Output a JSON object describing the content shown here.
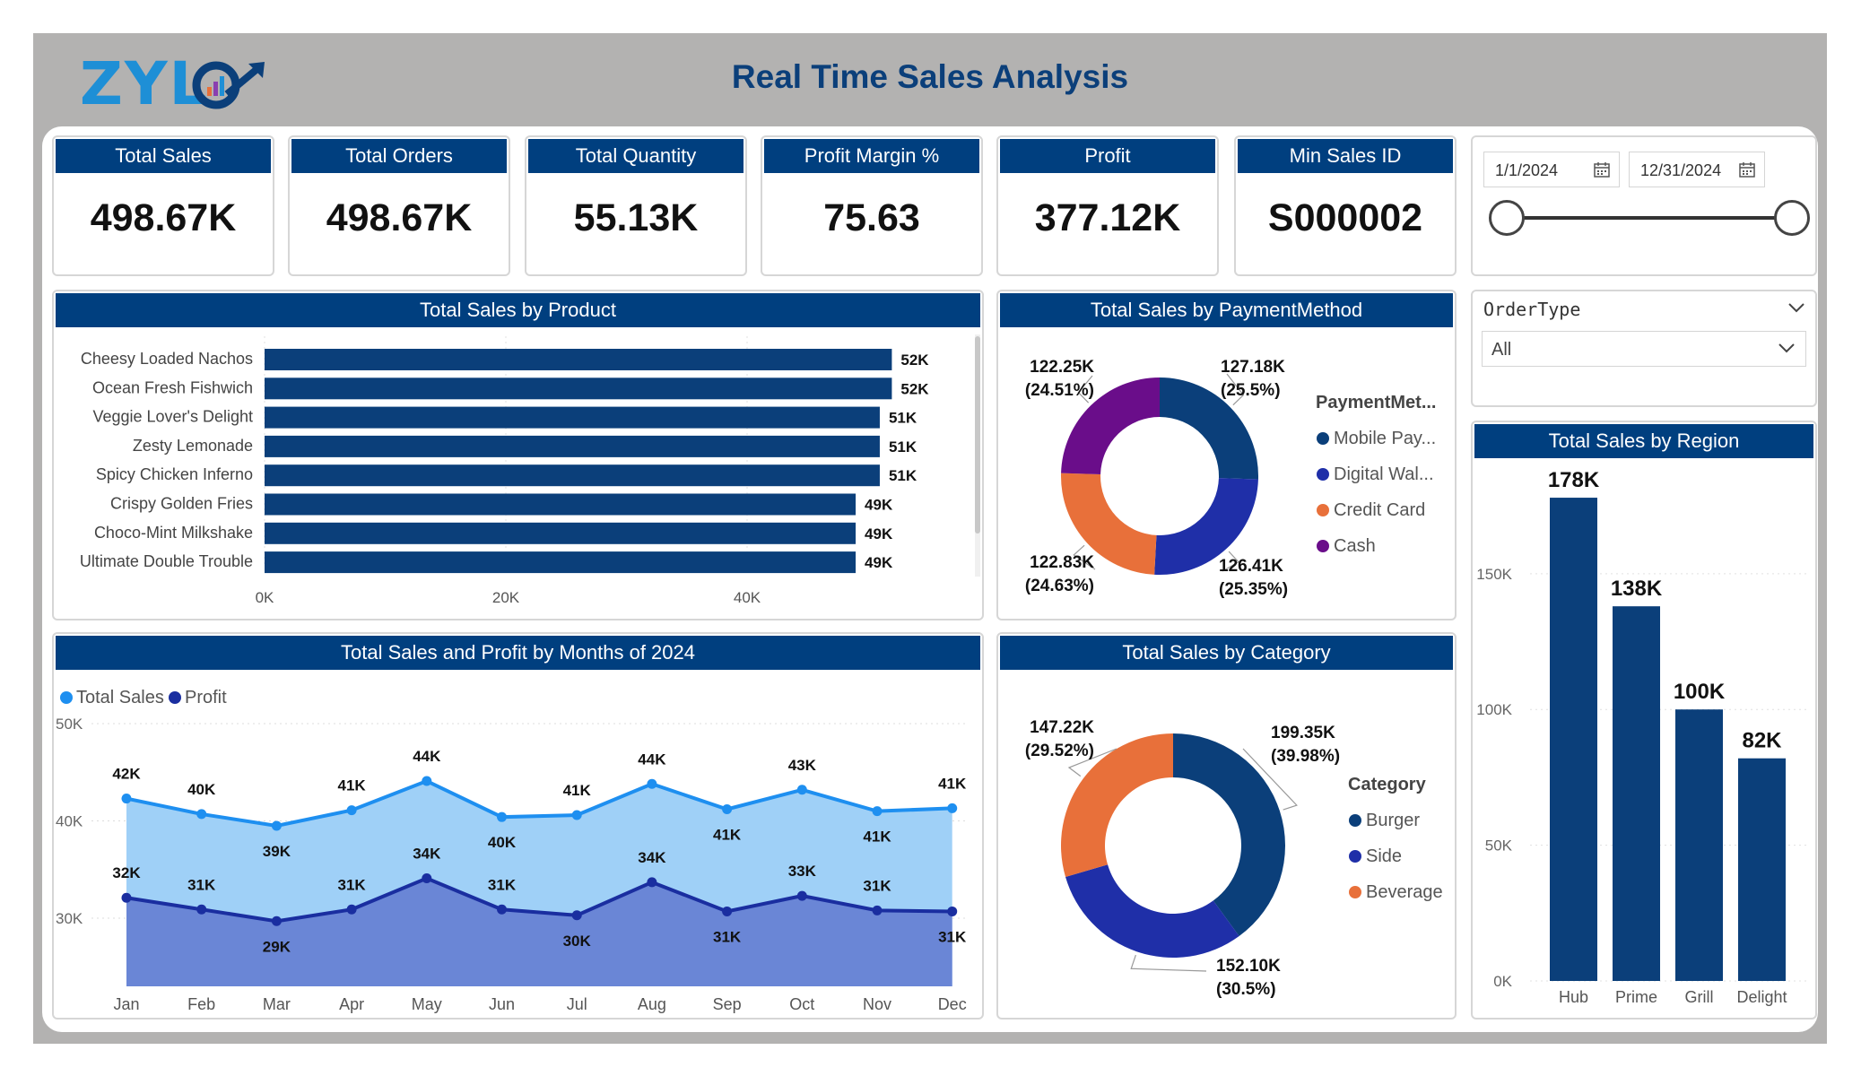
{
  "header": {
    "logo_text": "ZYL",
    "title": "Real Time Sales Analysis"
  },
  "kpis": [
    {
      "label": "Total Sales",
      "value": "498.67K"
    },
    {
      "label": "Total Orders",
      "value": "498.67K"
    },
    {
      "label": "Total Quantity",
      "value": "55.13K"
    },
    {
      "label": "Profit Margin %",
      "value": "75.63"
    },
    {
      "label": "Profit",
      "value": "377.12K"
    },
    {
      "label": "Min Sales ID",
      "value": "S000002"
    }
  ],
  "date_filter": {
    "start": "1/1/2024",
    "end": "12/31/2024",
    "icon": "calendar-icon",
    "range_selected_fraction": [
      0,
      1
    ]
  },
  "order_type_filter": {
    "title": "OrderType",
    "selected": "All"
  },
  "colors": {
    "header_bg": "#003f7f",
    "bar": "#0b3f7a",
    "total_sales_line": "#1e8ff0",
    "profit_line": "#1a2ea0",
    "orange": "#e8703a",
    "purple": "#6a0d8a",
    "royal_blue": "#1f2fa8"
  },
  "chart_data": [
    {
      "id": "product",
      "title": "Total Sales by Product",
      "type": "bar",
      "orientation": "horizontal",
      "categories": [
        "Cheesy Loaded Nachos",
        "Ocean Fresh Fishwich",
        "Veggie Lover's Delight",
        "Zesty Lemonade",
        "Spicy Chicken Inferno",
        "Crispy Golden Fries",
        "Choco-Mint Milkshake",
        "Ultimate Double Trouble"
      ],
      "values": [
        52000,
        52000,
        51000,
        51000,
        51000,
        49000,
        49000,
        49000
      ],
      "data_labels": [
        "52K",
        "52K",
        "51K",
        "51K",
        "51K",
        "49K",
        "49K",
        "49K"
      ],
      "x_ticks": [
        "0K",
        "20K",
        "40K"
      ],
      "xlim": [
        0,
        60000
      ]
    },
    {
      "id": "payment",
      "title": "Total Sales by PaymentMethod",
      "type": "pie",
      "legend_title": "PaymentMet...",
      "slices": [
        {
          "name": "Mobile Pay...",
          "value": 127180,
          "label": "127.18K",
          "pct": "(25.5%)",
          "color": "#0b3f7a"
        },
        {
          "name": "Digital Wal...",
          "value": 126410,
          "label": "126.41K",
          "pct": "(25.35%)",
          "color": "#1f2fa8"
        },
        {
          "name": "Credit Card",
          "value": 122830,
          "label": "122.83K",
          "pct": "(24.63%)",
          "color": "#e8703a"
        },
        {
          "name": "Cash",
          "value": 122250,
          "label": "122.25K",
          "pct": "(24.51%)",
          "color": "#6a0d8a"
        }
      ]
    },
    {
      "id": "region",
      "title": "Total Sales by Region",
      "type": "bar",
      "categories": [
        "Hub",
        "Prime",
        "Grill",
        "Delight"
      ],
      "values": [
        178000,
        138000,
        100000,
        82000
      ],
      "data_labels": [
        "178K",
        "138K",
        "100K",
        "82K"
      ],
      "y_ticks": [
        "0K",
        "50K",
        "100K",
        "150K"
      ],
      "ylim": [
        0,
        180000
      ]
    },
    {
      "id": "months",
      "title": "Total Sales and Profit by Months of 2024",
      "type": "area",
      "categories": [
        "Jan",
        "Feb",
        "Mar",
        "Apr",
        "May",
        "Jun",
        "Jul",
        "Aug",
        "Sep",
        "Oct",
        "Nov",
        "Dec"
      ],
      "series": [
        {
          "name": "Total Sales",
          "values": [
            42300,
            40700,
            39500,
            41100,
            44100,
            40400,
            40600,
            43800,
            41200,
            43200,
            41000,
            41300
          ],
          "labels": [
            "42K",
            "40K",
            "39K",
            "41K",
            "44K",
            "40K",
            "41K",
            "44K",
            "41K",
            "43K",
            "41K",
            "41K"
          ],
          "color": "#1e8ff0"
        },
        {
          "name": "Profit",
          "values": [
            32100,
            30900,
            29700,
            30900,
            34100,
            30900,
            30300,
            33700,
            30700,
            32300,
            30800,
            30700
          ],
          "labels": [
            "32K",
            "31K",
            "29K",
            "31K",
            "34K",
            "31K",
            "30K",
            "34K",
            "31K",
            "33K",
            "31K",
            "31K"
          ],
          "color": "#1a2ea0"
        }
      ],
      "y_ticks": [
        "30K",
        "40K",
        "50K"
      ],
      "ylim": [
        23000,
        50000
      ]
    },
    {
      "id": "category",
      "title": "Total Sales by Category",
      "type": "pie",
      "legend_title": "Category",
      "slices": [
        {
          "name": "Burger",
          "value": 199350,
          "label": "199.35K",
          "pct": "(39.98%)",
          "color": "#0b3f7a"
        },
        {
          "name": "Side",
          "value": 152100,
          "label": "152.10K",
          "pct": "(30.5%)",
          "color": "#1f2fa8"
        },
        {
          "name": "Beverage",
          "value": 147220,
          "label": "147.22K",
          "pct": "(29.52%)",
          "color": "#e8703a"
        }
      ]
    }
  ]
}
